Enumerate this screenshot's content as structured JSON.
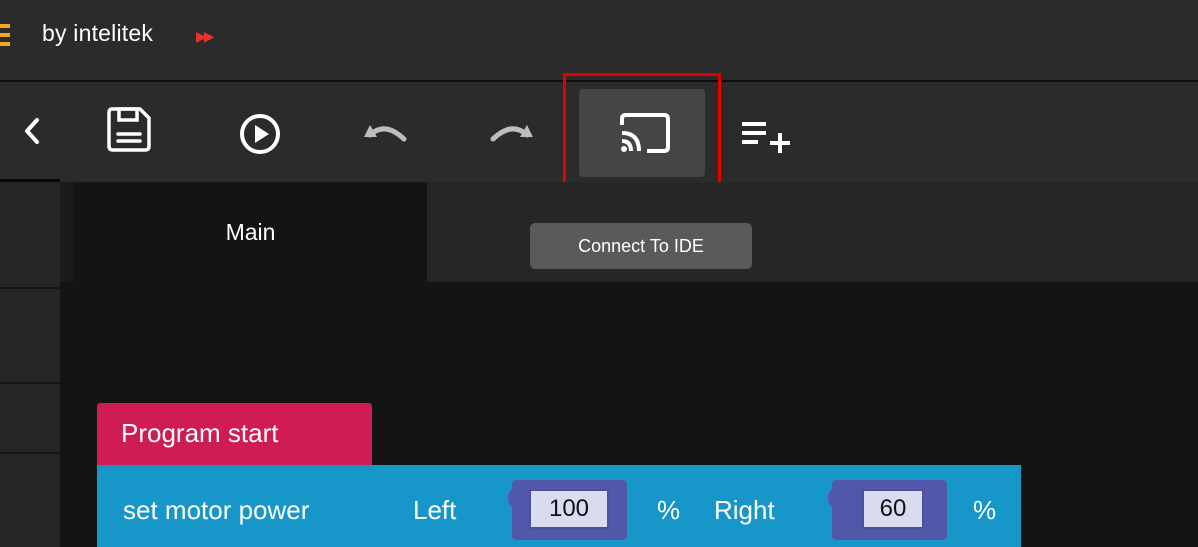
{
  "header": {
    "brand_text": "by intelitek",
    "brand_arrows": "▶▶"
  },
  "toolbar": {
    "items": [
      "chevron-left",
      "save",
      "run",
      "undo",
      "redo",
      "connect-to-ide",
      "add-list"
    ],
    "tooltip": "Connect To IDE",
    "highlight_color": "#e50000"
  },
  "tabs": [
    {
      "label": "Main",
      "active": true
    }
  ],
  "blocks": {
    "start": {
      "label": "Program start",
      "color": "#d01c54"
    },
    "motor": {
      "label": "set motor power",
      "left_label": "Left",
      "left_value": "100",
      "left_unit": "%",
      "right_label": "Right",
      "right_value": "60",
      "right_unit": "%",
      "color": "#1797c9",
      "socket_color": "#5258a9"
    }
  }
}
